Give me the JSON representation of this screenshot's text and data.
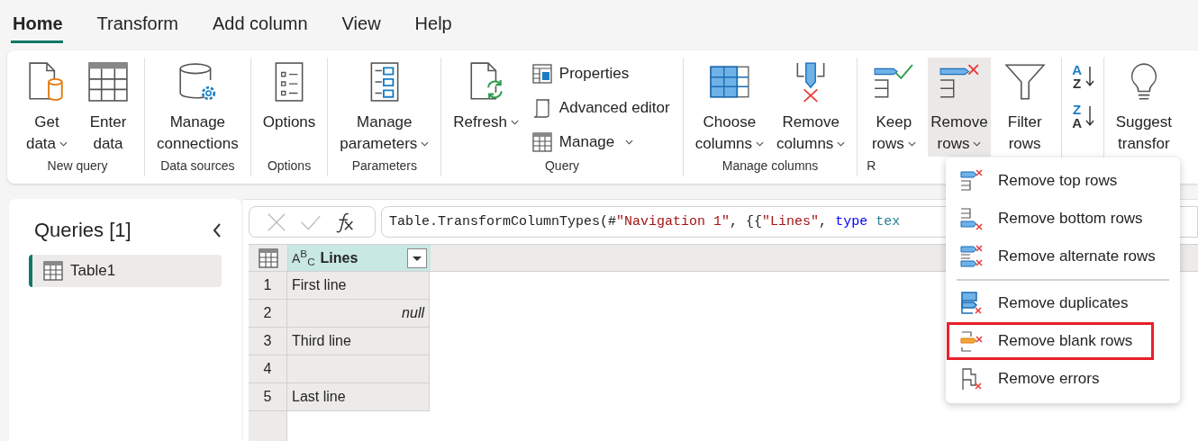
{
  "tabs": [
    {
      "label": "Home",
      "selected": true
    },
    {
      "label": "Transform",
      "selected": false
    },
    {
      "label": "Add column",
      "selected": false
    },
    {
      "label": "View",
      "selected": false
    },
    {
      "label": "Help",
      "selected": false
    }
  ],
  "ribbon": {
    "groups": [
      {
        "label": "New query",
        "items": [
          {
            "kind": "large",
            "lines": [
              "Get",
              "data"
            ],
            "dropdown": true,
            "open": false
          },
          {
            "kind": "large",
            "lines": [
              "Enter",
              "data"
            ],
            "dropdown": false,
            "open": false
          }
        ]
      },
      {
        "label": "Data sources",
        "items": [
          {
            "kind": "large",
            "lines": [
              "Manage",
              "connections"
            ],
            "dropdown": false,
            "open": false
          }
        ]
      },
      {
        "label": "Options",
        "items": [
          {
            "kind": "large",
            "lines": [
              "Options"
            ],
            "dropdown": false,
            "open": false
          }
        ]
      },
      {
        "label": "Parameters",
        "items": [
          {
            "kind": "large",
            "lines": [
              "Manage",
              "parameters"
            ],
            "dropdown": true,
            "open": false
          }
        ]
      },
      {
        "label": "Query",
        "items": [
          {
            "kind": "large",
            "lines": [
              "Refresh"
            ],
            "dropdown": true,
            "open": false
          },
          {
            "kind": "stack",
            "entries": [
              {
                "label": "Properties",
                "dropdown": false
              },
              {
                "label": "Advanced editor",
                "dropdown": false
              },
              {
                "label": "Manage",
                "dropdown": true
              }
            ]
          }
        ]
      },
      {
        "label": "Manage columns",
        "items": [
          {
            "kind": "large",
            "lines": [
              "Choose",
              "columns"
            ],
            "dropdown": true,
            "open": false
          },
          {
            "kind": "large",
            "lines": [
              "Remove",
              "columns"
            ],
            "dropdown": true,
            "open": false
          }
        ]
      },
      {
        "label": "R",
        "items": [
          {
            "kind": "large",
            "lines": [
              "Keep",
              "rows"
            ],
            "dropdown": true,
            "open": false
          },
          {
            "kind": "large",
            "lines": [
              "Remove",
              "rows"
            ],
            "dropdown": true,
            "open": true
          },
          {
            "kind": "large",
            "lines": [
              "Filter",
              "rows"
            ],
            "dropdown": false,
            "open": false
          }
        ]
      },
      {
        "items": [
          {
            "kind": "sort",
            "letters": [
              "A",
              "Z"
            ]
          },
          {
            "kind": "sort",
            "letters": [
              "Z",
              "A"
            ]
          }
        ]
      },
      {
        "items": [
          {
            "kind": "large",
            "lines": [
              "Suggest",
              "transfor"
            ],
            "dropdown": false,
            "open": false
          }
        ]
      }
    ]
  },
  "queries": {
    "title": "Queries [1]",
    "items": [
      {
        "label": "Table1",
        "selected": true
      }
    ]
  },
  "formula": {
    "segments": [
      {
        "text": "Table.TransformColumnTypes(#",
        "kind": "plain"
      },
      {
        "text": "\"Navigation 1\"",
        "kind": "string"
      },
      {
        "text": ", {{",
        "kind": "plain"
      },
      {
        "text": "\"Lines\"",
        "kind": "string"
      },
      {
        "text": ", ",
        "kind": "plain"
      },
      {
        "text": "type",
        "kind": "keyword"
      },
      {
        "text": "tex",
        "kind": "type"
      }
    ]
  },
  "table": {
    "column": {
      "name": "Lines",
      "type_badge": "A$^{B}$$_{C}$"
    },
    "rows": [
      {
        "number": "1",
        "kind": "text",
        "value": "First line"
      },
      {
        "number": "2",
        "kind": "null",
        "value": "null"
      },
      {
        "number": "3",
        "kind": "text",
        "value": "Third line"
      },
      {
        "number": "4",
        "kind": "blank"
      },
      {
        "number": "5",
        "kind": "text",
        "value": "Last line"
      }
    ]
  },
  "menu": {
    "sections": [
      {
        "items": [
          {
            "label": "Remove top rows",
            "highlighted": false
          },
          {
            "label": "Remove bottom rows",
            "highlighted": false
          },
          {
            "label": "Remove alternate rows",
            "highlighted": false
          }
        ]
      },
      {
        "items": [
          {
            "label": "Remove duplicates",
            "highlighted": false
          },
          {
            "label": "Remove blank rows",
            "highlighted": true
          },
          {
            "label": "Remove errors",
            "highlighted": false
          }
        ]
      }
    ]
  }
}
